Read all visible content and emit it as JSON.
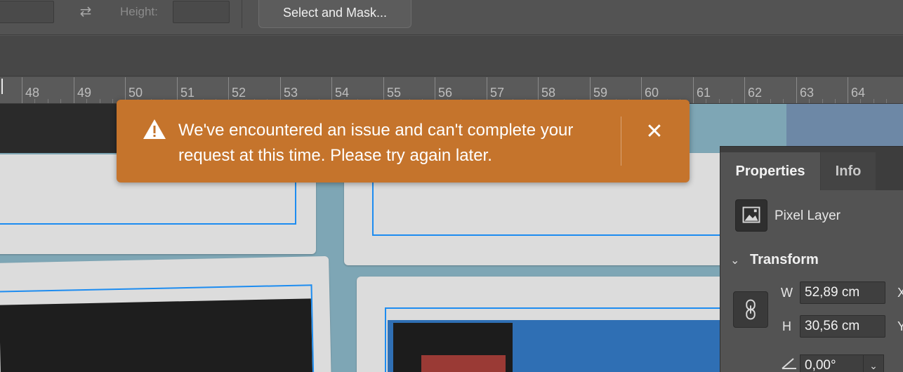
{
  "options_bar": {
    "height_label": "Height:",
    "select_and_mask_label": "Select and Mask...",
    "swap_icon": "swap-arrows-icon"
  },
  "ruler": {
    "labels": [
      "48",
      "49",
      "50",
      "51",
      "52",
      "53",
      "54",
      "55",
      "56",
      "57",
      "58",
      "59",
      "60",
      "61",
      "62",
      "63",
      "64"
    ]
  },
  "toast": {
    "type": "error",
    "color": "#c5742c",
    "icon": "warning-icon",
    "message": "We've encountered an issue and can't complete your request at this time. Please try again later.",
    "close_icon": "close-icon"
  },
  "properties_panel": {
    "tabs": [
      {
        "label": "Properties",
        "active": true
      },
      {
        "label": "Info",
        "active": false
      }
    ],
    "layer_type": "Pixel Layer",
    "section_title": "Transform",
    "w_label": "W",
    "w_value": "52,89 cm",
    "h_label": "H",
    "h_value": "30,56 cm",
    "x_label": "X",
    "y_label": "Y",
    "angle_value": "0,00°"
  },
  "colors": {
    "selection": "#1d8cf0",
    "panel_bg": "#535353"
  }
}
